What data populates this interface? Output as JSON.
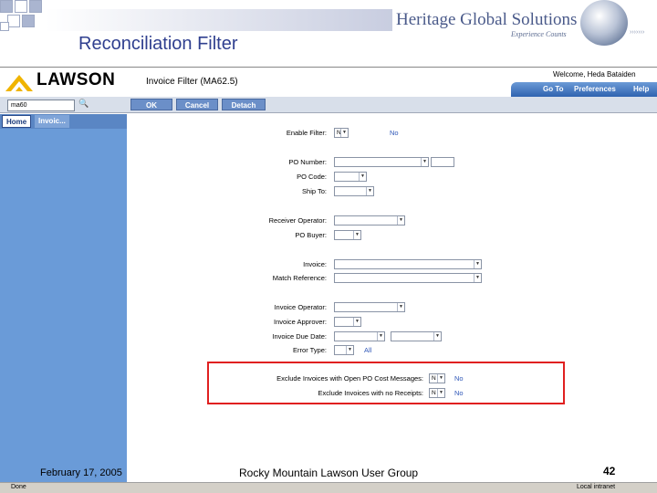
{
  "slide": {
    "title": "Reconciliation Filter",
    "brand_name": "Heritage Global Solutions",
    "brand_tagline": "Experience Counts",
    "footer_date": "February 17, 2005",
    "footer_center": "Rocky Mountain Lawson User Group",
    "page_number": "42"
  },
  "app": {
    "logo": "LAWSON",
    "title": "Invoice Filter (MA62.5)",
    "welcome": "Welcome, Heda Bataiden",
    "nav": {
      "goto": "Go To",
      "preferences": "Preferences",
      "help": "Help"
    },
    "search_value": "ma60",
    "toolbar": {
      "ok": "OK",
      "cancel": "Cancel",
      "detach": "Detach"
    },
    "tabs": {
      "home": "Home",
      "invoice": "Invoic..."
    },
    "status_left": "Done",
    "status_right": "Local intranet"
  },
  "form": {
    "enable_filter": {
      "label": "Enable Filter:",
      "selected": "N",
      "value": "No"
    },
    "po_number": {
      "label": "PO Number:"
    },
    "po_code": {
      "label": "PO Code:"
    },
    "ship_to": {
      "label": "Ship To:"
    },
    "receiver_operator": {
      "label": "Receiver Operator:"
    },
    "po_buyer": {
      "label": "PO Buyer:"
    },
    "invoice": {
      "label": "Invoice:"
    },
    "match_reference": {
      "label": "Match Reference:"
    },
    "invoice_operator": {
      "label": "Invoice Operator:"
    },
    "invoice_approver": {
      "label": "Invoice Approver:"
    },
    "invoice_due_date": {
      "label": "Invoice Due Date:"
    },
    "error_type": {
      "label": "Error Type:",
      "value": "All"
    },
    "exclude_open_po": {
      "label": "Exclude Invoices with Open PO Cost Messages:",
      "selected": "N",
      "value": "No"
    },
    "exclude_no_receipts": {
      "label": "Exclude Invoices with no Receipts:",
      "selected": "N",
      "value": "No"
    }
  },
  "colors": {
    "highlight": "#e02020",
    "title": "#2f3f8f",
    "sidebar": "#6a9bd8",
    "value_text": "#3058b8"
  }
}
